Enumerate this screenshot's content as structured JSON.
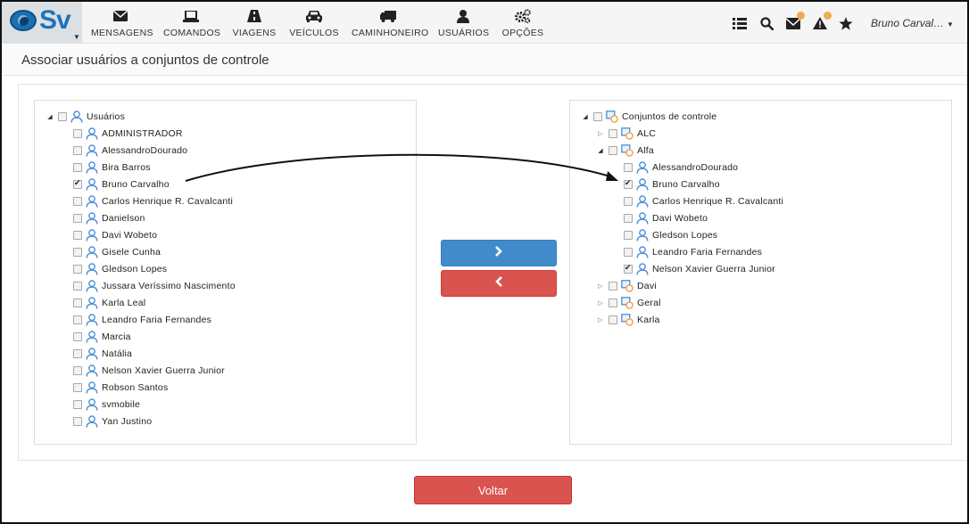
{
  "brand": {
    "logo_text": "Sv",
    "caret": "▼"
  },
  "nav": [
    {
      "id": "mensagens",
      "label": "MENSAGENS",
      "icon": "envelope-icon"
    },
    {
      "id": "comandos",
      "label": "COMANDOS",
      "icon": "laptop-icon"
    },
    {
      "id": "viagens",
      "label": "VIAGENS",
      "icon": "road-icon"
    },
    {
      "id": "veiculos",
      "label": "VEÍCULOS",
      "icon": "car-icon"
    },
    {
      "id": "caminhoneiro",
      "label": "CAMINHONEIRO",
      "icon": "truck-icon"
    },
    {
      "id": "usuarios",
      "label": "USUÁRIOS",
      "icon": "user-icon"
    },
    {
      "id": "opcoes",
      "label": "OPÇÕES",
      "icon": "cogs-icon"
    }
  ],
  "header_right": {
    "icons": [
      "list-icon",
      "search-icon",
      "inbox-alert-icon",
      "warning-alert-icon",
      "star-icon"
    ],
    "user_name": "Bruno Carval…",
    "user_caret": "▼"
  },
  "page_title": "Associar usuários a conjuntos de controle",
  "left_tree": {
    "root": {
      "label": "Usuários",
      "expanded": true,
      "toggle": "◢"
    },
    "users": [
      {
        "label": "ADMINISTRADOR",
        "checked": false
      },
      {
        "label": "AlessandroDourado",
        "checked": false
      },
      {
        "label": "Bira Barros",
        "checked": false
      },
      {
        "label": "Bruno Carvalho",
        "checked": true
      },
      {
        "label": "Carlos Henrique R. Cavalcanti",
        "checked": false
      },
      {
        "label": "Danielson",
        "checked": false
      },
      {
        "label": "Davi Wobeto",
        "checked": false
      },
      {
        "label": "Gisele Cunha",
        "checked": false
      },
      {
        "label": "Gledson Lopes",
        "checked": false
      },
      {
        "label": "Jussara Veríssimo Nascimento",
        "checked": false
      },
      {
        "label": "Karla Leal",
        "checked": false
      },
      {
        "label": "Leandro Faria Fernandes",
        "checked": false
      },
      {
        "label": "Marcia",
        "checked": false
      },
      {
        "label": "Natália",
        "checked": false
      },
      {
        "label": "Nelson Xavier Guerra Junior",
        "checked": false
      },
      {
        "label": "Robson Santos",
        "checked": false
      },
      {
        "label": "svmobile",
        "checked": false
      },
      {
        "label": "Yan Justino",
        "checked": false
      }
    ]
  },
  "right_tree": {
    "root": {
      "label": "Conjuntos de controle",
      "expanded": true,
      "toggle": "◢"
    },
    "groups": [
      {
        "label": "ALC",
        "expanded": false,
        "toggle": "▷",
        "members": []
      },
      {
        "label": "Alfa",
        "expanded": true,
        "toggle": "◢",
        "members": [
          {
            "label": "AlessandroDourado",
            "checked": false
          },
          {
            "label": "Bruno Carvalho",
            "checked": true
          },
          {
            "label": "Carlos Henrique R. Cavalcanti",
            "checked": false
          },
          {
            "label": "Davi Wobeto",
            "checked": false
          },
          {
            "label": "Gledson Lopes",
            "checked": false
          },
          {
            "label": "Leandro Faria Fernandes",
            "checked": false
          },
          {
            "label": "Nelson Xavier Guerra Junior",
            "checked": true
          }
        ]
      },
      {
        "label": "Davi",
        "expanded": false,
        "toggle": "▷",
        "members": []
      },
      {
        "label": "Geral",
        "expanded": false,
        "toggle": "▷",
        "members": []
      },
      {
        "label": "Karla",
        "expanded": false,
        "toggle": "▷",
        "members": []
      }
    ]
  },
  "buttons": {
    "add_symbol": "›",
    "remove_symbol": "‹",
    "back_label": "Voltar"
  },
  "colors": {
    "primary": "#428bca",
    "danger": "#d9534f",
    "icon_blue": "#4a90d9",
    "icon_orange": "#f0a040",
    "badge": "#f0ad4e"
  }
}
